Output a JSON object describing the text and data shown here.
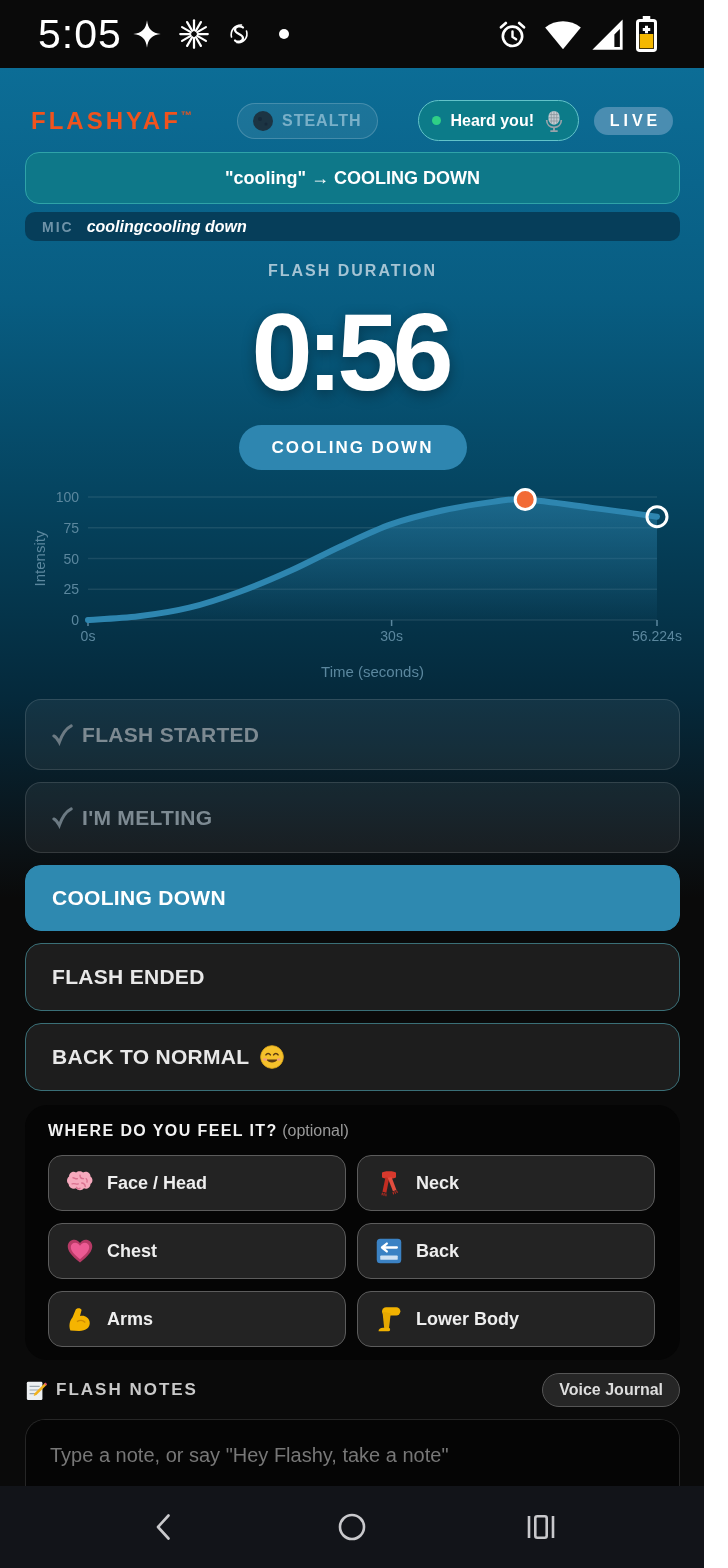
{
  "status_bar": {
    "time": "5:05"
  },
  "header": {
    "logo": "FLASHYAF$^{™}$",
    "stealth": {
      "label": "STEALTH",
      "on": false
    },
    "voice_status": {
      "label": "Heard you!",
      "listening": true
    },
    "live_badge": {
      "label": "LIVE"
    }
  },
  "command_banner": {
    "text": "\"cooling\" → COOLING DOWN"
  },
  "mic_transcript": {
    "label": "MIC",
    "text": "coolingcooling down"
  },
  "timer": {
    "label": "FLASH DURATION",
    "value": "0:56",
    "phase": "COOLING DOWN"
  },
  "intensity_chart": {
    "chart_data": {
      "type": "area",
      "xlabel": "Time (seconds)",
      "ylabel": "Intensity",
      "x": [
        0,
        5,
        10,
        15,
        20,
        25,
        30,
        35,
        40,
        43.2,
        50,
        56.224
      ],
      "series": [
        {
          "color": "#2e86b0",
          "values": [
            0,
            3,
            10,
            23,
            40,
            60,
            78,
            89,
            96,
            98,
            91,
            84
          ]
        }
      ],
      "xlim": [
        0,
        56.224
      ],
      "ylim": [
        0,
        100
      ],
      "xticks": [
        {
          "value": 0,
          "label": "0s"
        },
        {
          "value": 30,
          "label": "30s"
        },
        {
          "value": 56.224,
          "label": "56.224s"
        }
      ],
      "yticks": [
        0,
        25,
        50,
        75,
        100
      ],
      "grid": true
    }
  },
  "stages": [
    {
      "kind": "start",
      "label": "FLASH STARTED",
      "completed": true,
      "selected": false
    },
    {
      "kind": "peak",
      "label": "I'M MELTING",
      "completed": true,
      "selected": false
    },
    {
      "kind": "cooling",
      "label": "COOLING DOWN",
      "completed": false,
      "selected": true
    },
    {
      "kind": "end",
      "label": "FLASH ENDED",
      "completed": false,
      "selected": false
    },
    {
      "kind": "normal",
      "label": "BACK TO NORMAL",
      "completed": false,
      "selected": false
    }
  ],
  "body_areas": {
    "title": "**WHERE DO YOU FEEL IT?** (optional)",
    "options": [
      {
        "kind": "head",
        "label": "Face / Head",
        "selected": false
      },
      {
        "kind": "neck",
        "label": "Neck",
        "selected": false
      },
      {
        "kind": "chest",
        "label": "Chest",
        "selected": false
      },
      {
        "kind": "back",
        "label": "Back",
        "selected": false
      },
      {
        "kind": "arms",
        "label": "Arms",
        "selected": false
      },
      {
        "kind": "lower_body",
        "label": "Lower Body",
        "selected": false
      }
    ]
  },
  "notes": {
    "title": "FLASH NOTES",
    "voice_button": "Voice Journal",
    "placeholder": "Type a note, or say \"Hey Flashy, take a note\""
  }
}
